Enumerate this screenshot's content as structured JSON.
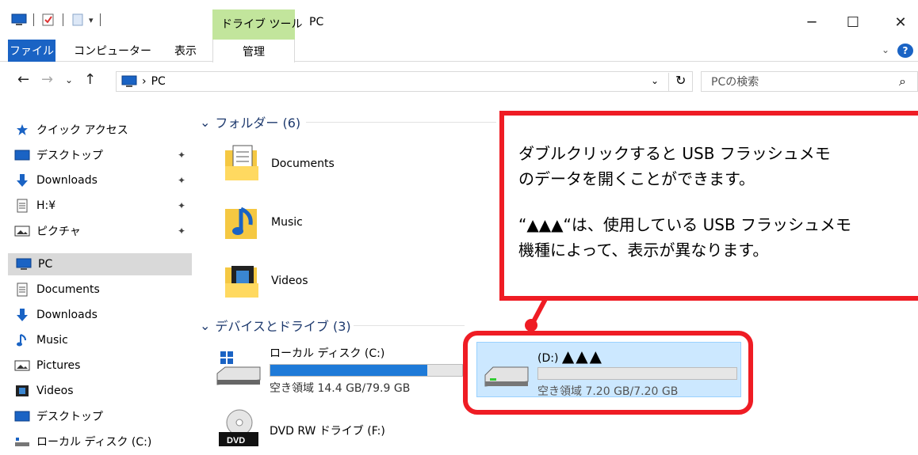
{
  "titlebar": {
    "context_tab": "ドライブ ツール",
    "title": "PC",
    "minimize": "─",
    "maximize": "☐",
    "close": "✕"
  },
  "ribbon": {
    "tabs": [
      "ファイル",
      "コンピューター",
      "表示",
      "管理"
    ],
    "expand": "⌄",
    "help": "?"
  },
  "address": {
    "path": "PC",
    "separator": "›",
    "dropdown": "⌄",
    "refresh": "↻",
    "search_placeholder": "PCの検索",
    "search_icon": "⌕"
  },
  "nav": {
    "back": "←",
    "forward": "→",
    "recent": "⌄",
    "up": "↑"
  },
  "sidebar": {
    "quick_access": "クイック アクセス",
    "quick_items": [
      {
        "label": "デスクトップ",
        "icon": "desktop-icon"
      },
      {
        "label": "Downloads",
        "icon": "download-arrow-icon"
      },
      {
        "label": "H:¥",
        "icon": "document-icon"
      },
      {
        "label": "ピクチャ",
        "icon": "pictures-icon"
      }
    ],
    "pin": "📌",
    "pc": "PC",
    "pc_items": [
      {
        "label": "Documents",
        "icon": "document-icon"
      },
      {
        "label": "Downloads",
        "icon": "download-arrow-icon"
      },
      {
        "label": "Music",
        "icon": "music-note-icon"
      },
      {
        "label": "Pictures",
        "icon": "pictures-icon"
      },
      {
        "label": "Videos",
        "icon": "film-icon"
      },
      {
        "label": "デスクトップ",
        "icon": "desktop-icon"
      },
      {
        "label": "ローカル ディスク (C:)",
        "icon": "drive-icon"
      }
    ]
  },
  "content": {
    "folders_header": "フォルダー (6)",
    "folders": [
      "Documents",
      "Music",
      "Videos"
    ],
    "devices_header": "デバイスとドライブ (3)",
    "drives": [
      {
        "name": "ローカル ディスク (C:)",
        "free": "空き領域 14.4 GB/79.9 GB",
        "used_fraction": 0.82
      },
      {
        "name": "(D:)",
        "suffix": "▲▲▲",
        "free": "空き領域 7.20 GB/7.20 GB",
        "used_fraction": 0.0
      },
      {
        "name": "DVD RW ドライブ (F:)"
      }
    ]
  },
  "callout": {
    "line1": "ダブルクリックすると USB フラッシュメモ",
    "line2": "のデータを開くことができます。",
    "line3": "“▲▲▲“は、使用している USB フラッシュメモ",
    "line4": "機種によって、表示が異なります。"
  },
  "colors": {
    "accent": "#1a63c4",
    "context_green": "#c2e59c",
    "selection": "#cce8ff",
    "annotation_red": "#ef1c24"
  }
}
